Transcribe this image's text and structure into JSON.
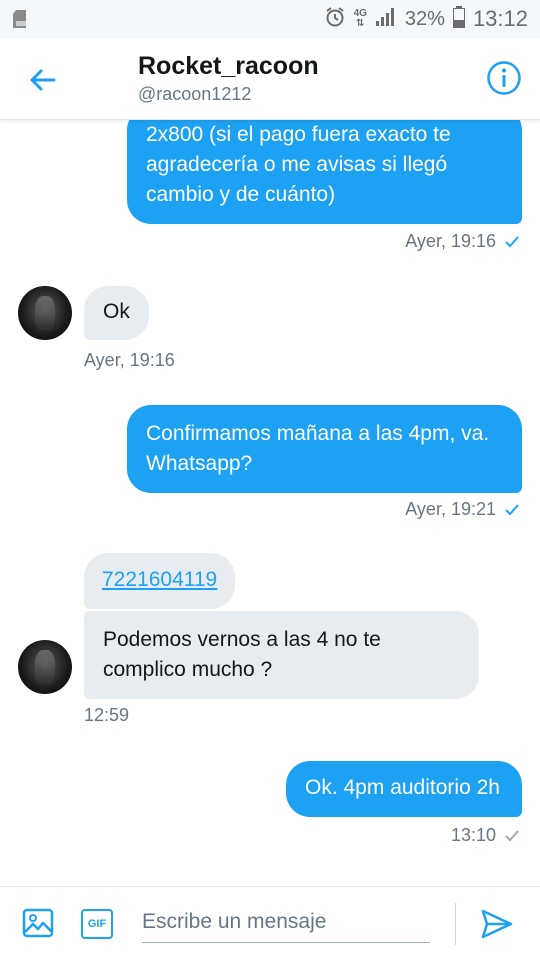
{
  "status_bar": {
    "battery_percent": "32%",
    "time": "13:12",
    "network": "4G",
    "icons": [
      "sd-card-icon",
      "alarm-icon",
      "network-4g-icon",
      "signal-icon",
      "battery-icon"
    ]
  },
  "header": {
    "name": "Rocket_racoon",
    "handle": "@racoon1212",
    "icons": [
      "back-arrow-icon",
      "info-icon"
    ]
  },
  "colors": {
    "accent": "#1da1f2",
    "incoming_bubble": "#e6ecf0",
    "meta_text": "#657786"
  },
  "messages": [
    {
      "direction": "outgoing",
      "lines": [
        "2x800  (si el pago fuera exacto te",
        "agradecería o me avisas si llegó",
        "cambio y de cuánto)"
      ],
      "time": "Ayer, 19:16",
      "status": "read"
    },
    {
      "direction": "incoming",
      "text": "Ok",
      "time": "Ayer, 19:16"
    },
    {
      "direction": "outgoing",
      "lines": [
        "Confirmamos mañana  a las 4pm, va.",
        "Whatsapp?"
      ],
      "time": "Ayer, 19:21",
      "status": "read"
    },
    {
      "direction": "incoming",
      "text": "7221604119",
      "is_link": true
    },
    {
      "direction": "incoming",
      "lines": [
        "Podemos vernos a las 4 no te",
        "complico mucho ?"
      ],
      "time": "12:59"
    },
    {
      "direction": "outgoing",
      "text": "Ok. 4pm auditorio 2h",
      "time": "13:10",
      "status": "sent"
    }
  ],
  "compose": {
    "placeholder": "Escribe un mensaje",
    "gif_label": "GIF",
    "icons": [
      "image-icon",
      "gif-icon",
      "send-icon"
    ]
  }
}
